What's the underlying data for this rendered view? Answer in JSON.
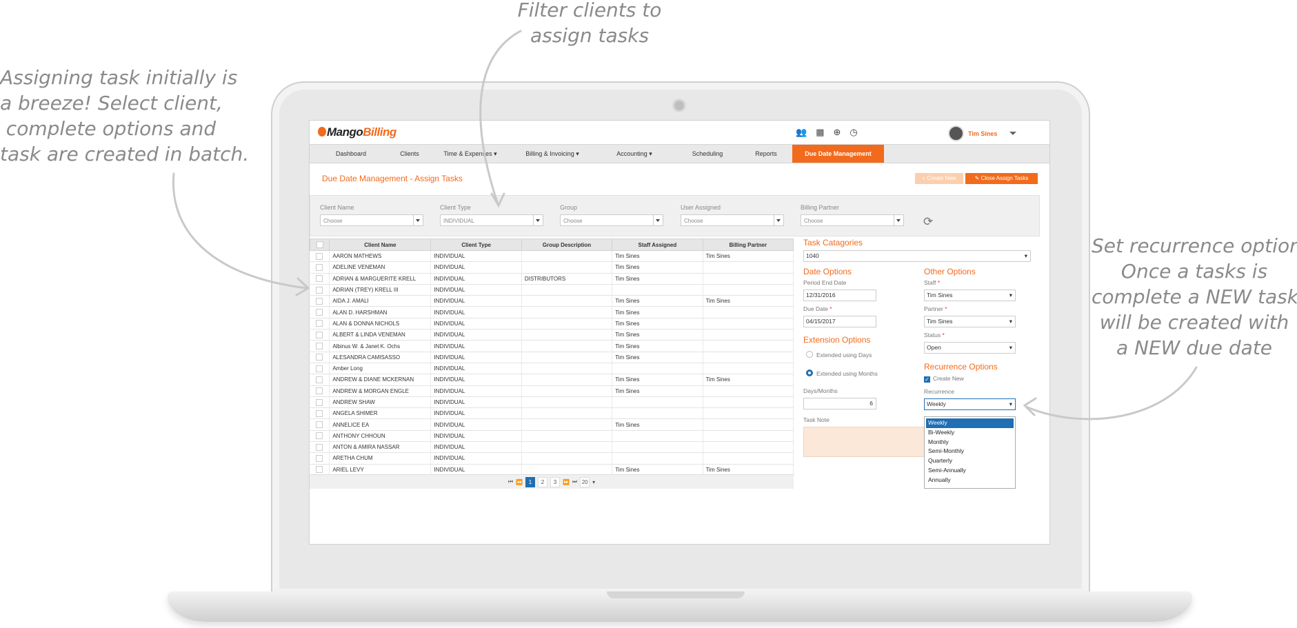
{
  "annotations": {
    "left": [
      "Assigning task initially is",
      "a breeze! Select client,",
      "complete options and",
      "task are created in batch."
    ],
    "top": [
      "Filter clients to",
      "assign tasks"
    ],
    "right": [
      "Set recurrence options.",
      "Once a tasks is",
      "complete a NEW task",
      "will be created with",
      "a NEW due date"
    ]
  },
  "app": {
    "logo_part1": "Mango",
    "logo_part2": "Billing",
    "user_name": "Tim Sines",
    "header_icons": [
      "users-icon",
      "calendar-icon",
      "plus-circle-icon",
      "clock-icon"
    ]
  },
  "nav": [
    {
      "label": "Dashboard"
    },
    {
      "label": "Clients"
    },
    {
      "label": "Time & Expenses ▾"
    },
    {
      "label": "Billing & Invoicing ▾"
    },
    {
      "label": "Accounting ▾"
    },
    {
      "label": "Scheduling"
    },
    {
      "label": "Reports"
    },
    {
      "label": "Due Date Management"
    }
  ],
  "page": {
    "title": "Due Date Management - Assign Tasks",
    "create_new": "+ Create New",
    "close_assign": "✎ Close Assign Tasks"
  },
  "filters": [
    {
      "label": "Client Name",
      "value": "Choose"
    },
    {
      "label": "Client Type",
      "value": "INDIVIDUAL"
    },
    {
      "label": "Group",
      "value": "Choose"
    },
    {
      "label": "User Assigned",
      "value": "Choose"
    },
    {
      "label": "Billing Partner",
      "value": "Choose"
    }
  ],
  "table": {
    "headers": [
      "Client Name",
      "Client Type",
      "Group Description",
      "Staff Assigned",
      "Billing Partner"
    ],
    "rows": [
      [
        "AARON MATHEWS",
        "INDIVIDUAL",
        "",
        "Tim Sines",
        "Tim Sines"
      ],
      [
        "ADELINE VENEMAN",
        "INDIVIDUAL",
        "",
        "Tim Sines",
        ""
      ],
      [
        "ADRIAN & MARGUERITE KRELL",
        "INDIVIDUAL",
        "DISTRIBUTORS",
        "Tim Sines",
        ""
      ],
      [
        "ADRIAN (TREY) KRELL III",
        "INDIVIDUAL",
        "",
        "",
        ""
      ],
      [
        "AIDA J. AMALI",
        "INDIVIDUAL",
        "",
        "Tim Sines",
        "Tim Sines"
      ],
      [
        "ALAN D. HARSHMAN",
        "INDIVIDUAL",
        "",
        "Tim Sines",
        ""
      ],
      [
        "ALAN & DONNA NICHOLS",
        "INDIVIDUAL",
        "",
        "Tim Sines",
        ""
      ],
      [
        "ALBERT & LINDA VENEMAN",
        "INDIVIDUAL",
        "",
        "Tim Sines",
        ""
      ],
      [
        "Albinus W. & Janet K. Ochs",
        "INDIVIDUAL",
        "",
        "Tim Sines",
        ""
      ],
      [
        "ALESANDRA CAMISASSO",
        "INDIVIDUAL",
        "",
        "Tim Sines",
        ""
      ],
      [
        "Amber Long",
        "INDIVIDUAL",
        "",
        "",
        ""
      ],
      [
        "ANDREW & DIANE MCKERNAN",
        "INDIVIDUAL",
        "",
        "Tim Sines",
        "Tim Sines"
      ],
      [
        "ANDREW & MORGAN ENGLE",
        "INDIVIDUAL",
        "",
        "Tim Sines",
        ""
      ],
      [
        "ANDREW SHAW",
        "INDIVIDUAL",
        "",
        "",
        ""
      ],
      [
        "ANGELA SHIMER",
        "INDIVIDUAL",
        "",
        "",
        ""
      ],
      [
        "ANNELICE EA",
        "INDIVIDUAL",
        "",
        "Tim Sines",
        ""
      ],
      [
        "ANTHONY CHHOUN",
        "INDIVIDUAL",
        "",
        "",
        ""
      ],
      [
        "ANTON & AMIRA NASSAR",
        "INDIVIDUAL",
        "",
        "",
        ""
      ],
      [
        "ARETHA CHUM",
        "INDIVIDUAL",
        "",
        "",
        ""
      ],
      [
        "ARIEL LEVY",
        "INDIVIDUAL",
        "",
        "Tim Sines",
        "Tim Sines"
      ]
    ]
  },
  "pager": {
    "pages": [
      "1",
      "2",
      "3"
    ],
    "page_size": "20"
  },
  "right_panel": {
    "task_categories": {
      "title": "Task Catagories",
      "value": "1040"
    },
    "date_options": {
      "title": "Date Options",
      "period_end_label": "Period End Date",
      "period_end_value": "12/31/2016",
      "due_date_label": "Due Date",
      "due_date_value": "04/15/2017"
    },
    "extension_options": {
      "title": "Extension Options",
      "opt_days": "Extended using Days",
      "opt_months": "Extended using Months",
      "days_months_label": "Days/Months",
      "days_months_value": "6"
    },
    "task_note_label": "Task Note",
    "other_options": {
      "title": "Other Options",
      "staff_label": "Staff",
      "staff_value": "Tim Sines",
      "partner_label": "Partner",
      "partner_value": "Tim Sines",
      "status_label": "Status",
      "status_value": "Open"
    },
    "recurrence": {
      "title": "Recurrence Options",
      "create_new_label": "Create New",
      "recurrence_label": "Recurrence",
      "value": "Weekly",
      "options": [
        "Weekly",
        "Bi-Weekly",
        "Monthly",
        "Semi-Monthly",
        "Quarterly",
        "Semi-Annually",
        "Annually"
      ]
    },
    "required_mark": "*"
  },
  "colors": {
    "accent": "#f26a1b",
    "selection": "#1f6fb2",
    "annotation": "#8a8a8a"
  }
}
